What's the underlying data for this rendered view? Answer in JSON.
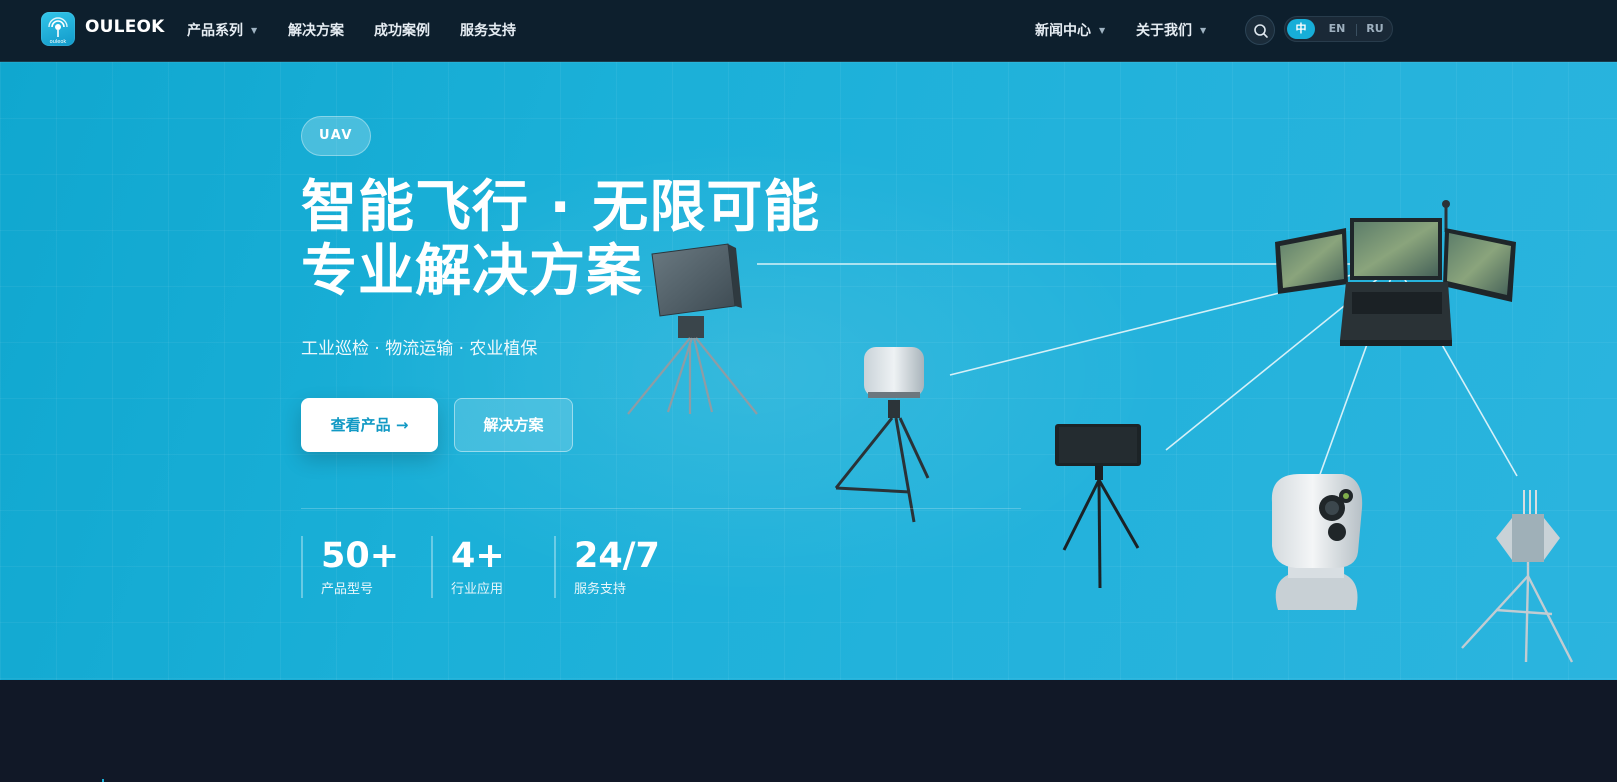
{
  "brand": {
    "name": "OULEOK",
    "logo_text": "ouleok"
  },
  "nav": {
    "left": [
      "产品系列",
      "解决方案",
      "成功案例",
      "服务支持"
    ],
    "right": [
      "新闻中心",
      "关于我们"
    ],
    "languages": [
      "中",
      "EN",
      "RU"
    ],
    "active_language": "中"
  },
  "hero": {
    "badge": "UAV",
    "title_line1": "智能飞行 · 无限可能",
    "title_line2": "专业解决方案",
    "subtitle": "工业巡检 · 物流运输 · 农业植保",
    "primary_button": "查看产品 →",
    "secondary_button": "解决方案",
    "stats": [
      {
        "value": "50+",
        "label": "产品型号"
      },
      {
        "value": "4+",
        "label": "行业应用"
      },
      {
        "value": "24/7",
        "label": "服务支持"
      }
    ]
  },
  "icons": {
    "search": "search-icon",
    "caret": "caret-down-icon"
  },
  "colors": {
    "nav_bg": "#0d1f2d",
    "hero_bg": "#1bb0d8",
    "accent": "#17aed8",
    "footer_bg": "#111827"
  }
}
